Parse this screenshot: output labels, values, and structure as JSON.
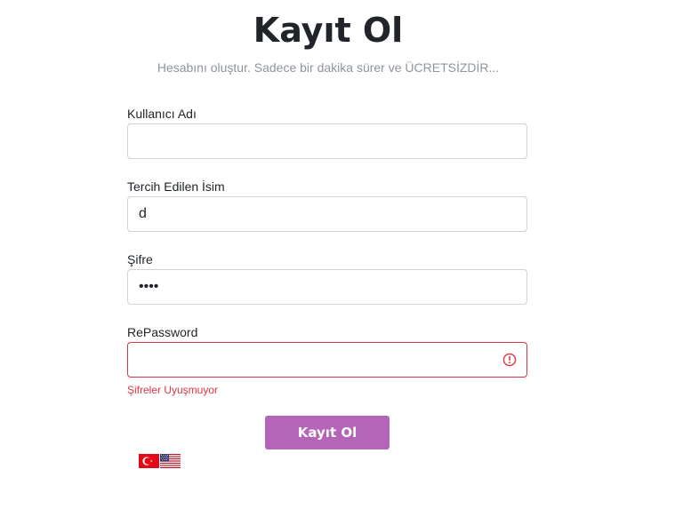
{
  "page": {
    "title": "Kayıt Ol",
    "subtitle": "Hesabını oluştur. Sadece bir dakika sürer ve ÜCRETSİZDİR..."
  },
  "form": {
    "username": {
      "label": "Kullanıcı Adı",
      "value": ""
    },
    "preferred_name": {
      "label": "Tercih Edilen İsim",
      "value": "d"
    },
    "password": {
      "label": "Şifre",
      "value": "abcd"
    },
    "repassword": {
      "label": "RePassword",
      "value": "",
      "error": "Şifreler Uyuşmuyor"
    },
    "submit_label": "Kayıt Ol"
  },
  "languages": [
    {
      "code": "tr",
      "icon": "turkey-flag-icon"
    },
    {
      "code": "en",
      "icon": "usa-flag-icon"
    }
  ],
  "colors": {
    "accent": "#b565b7",
    "error": "#dc3545",
    "border": "#ced4da",
    "muted_text": "#8f959b"
  }
}
